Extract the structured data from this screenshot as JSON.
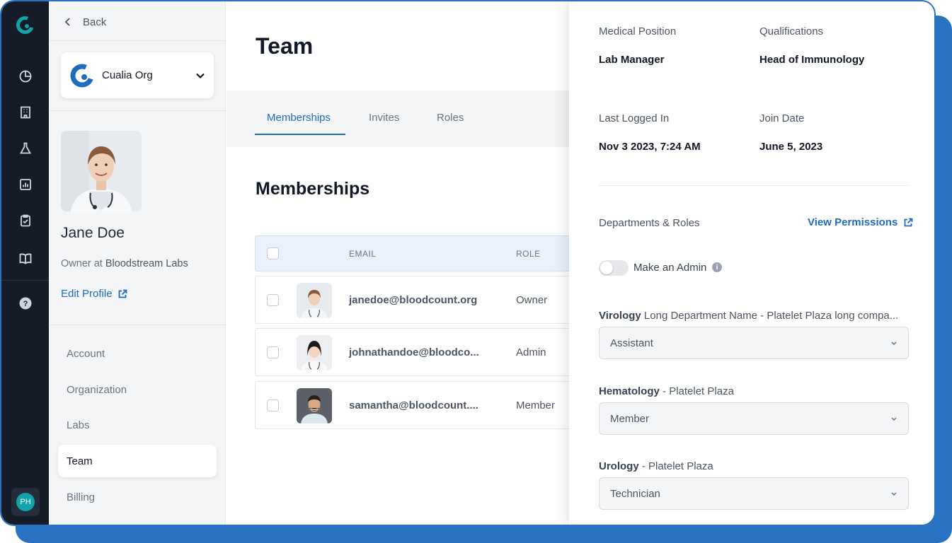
{
  "rail": {
    "icons": [
      "pie-chart-icon",
      "building-icon",
      "flask-icon",
      "bar-chart-icon",
      "clipboard-check-icon",
      "book-icon",
      "help-icon"
    ],
    "avatar_initials": "PH"
  },
  "sidebar": {
    "back_label": "Back",
    "org_name": "Cualia Org",
    "user_name": "Jane Doe",
    "user_role_prefix": "Owner at ",
    "user_org": "Bloodstream Labs",
    "edit_profile": "Edit Profile",
    "nav": [
      {
        "label": "Account"
      },
      {
        "label": "Organization"
      },
      {
        "label": "Labs"
      },
      {
        "label": "Team"
      },
      {
        "label": "Billing"
      }
    ]
  },
  "main": {
    "title": "Team",
    "tabs": [
      {
        "label": "Memberships"
      },
      {
        "label": "Invites"
      },
      {
        "label": "Roles"
      }
    ],
    "section_title": "Memberships",
    "table": {
      "columns": [
        "EMAIL",
        "ROLE"
      ],
      "rows": [
        {
          "email": "janedoe@bloodcount.org",
          "role": "Owner"
        },
        {
          "email": "johnathandoe@bloodco...",
          "role": "Admin"
        },
        {
          "email": "samantha@bloodcount....",
          "role": "Member"
        }
      ]
    }
  },
  "panel": {
    "medical_position_label": "Medical Position",
    "medical_position": "Lab Manager",
    "qualifications_label": "Qualifications",
    "qualifications": "Head of Immunology",
    "last_logged_label": "Last Logged In",
    "last_logged": "Nov 3 2023, 7:24 AM",
    "join_date_label": "Join Date",
    "join_date": "June 5, 2023",
    "departments_label": "Departments & Roles",
    "view_permissions": "View Permissions",
    "make_admin": "Make an Admin",
    "make_admin_on": false,
    "departments": [
      {
        "name": "Virology",
        "detail": " Long Department Name - Platelet Plaza long compa...",
        "role": "Assistant"
      },
      {
        "name": "Hematology",
        "detail": " - Platelet Plaza",
        "role": "Member"
      },
      {
        "name": "Urology",
        "detail": " - Platelet Plaza",
        "role": "Technician"
      }
    ]
  },
  "colors": {
    "accent": "#1f6bbf",
    "frame": "#2a72c2",
    "rail": "#141c28",
    "logo_teal": "#13a3a8"
  }
}
